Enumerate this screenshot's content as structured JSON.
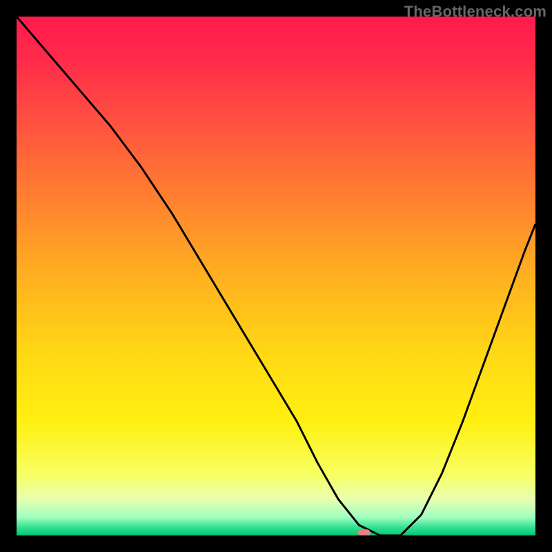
{
  "watermark": "TheBottleneck.com",
  "chart_data": {
    "type": "line",
    "title": "",
    "xlabel": "",
    "ylabel": "",
    "xlim": [
      0,
      100
    ],
    "ylim": [
      0,
      100
    ],
    "x": [
      0,
      6,
      12,
      18,
      24,
      30,
      36,
      42,
      48,
      54,
      58,
      62,
      66,
      70,
      74,
      78,
      82,
      86,
      90,
      94,
      98,
      100
    ],
    "values": [
      100,
      93,
      86,
      79,
      71,
      62,
      52,
      42,
      32,
      22,
      14,
      7,
      2,
      0,
      0,
      4,
      12,
      22,
      33,
      44,
      55,
      60
    ],
    "marker": {
      "x": 67,
      "y": 0.5
    },
    "gradient_stops": [
      {
        "offset": 0.0,
        "color": "#ff1a4d"
      },
      {
        "offset": 0.08,
        "color": "#ff2a4a"
      },
      {
        "offset": 0.2,
        "color": "#ff5040"
      },
      {
        "offset": 0.35,
        "color": "#ff8030"
      },
      {
        "offset": 0.5,
        "color": "#ffb020"
      },
      {
        "offset": 0.65,
        "color": "#ffd815"
      },
      {
        "offset": 0.78,
        "color": "#fff010"
      },
      {
        "offset": 0.88,
        "color": "#f8ff60"
      },
      {
        "offset": 0.93,
        "color": "#e8ffb0"
      },
      {
        "offset": 0.965,
        "color": "#a0ffc0"
      },
      {
        "offset": 0.985,
        "color": "#30e090"
      },
      {
        "offset": 1.0,
        "color": "#00c870"
      }
    ],
    "marker_color": "#e88080",
    "line_color": "#000000"
  }
}
